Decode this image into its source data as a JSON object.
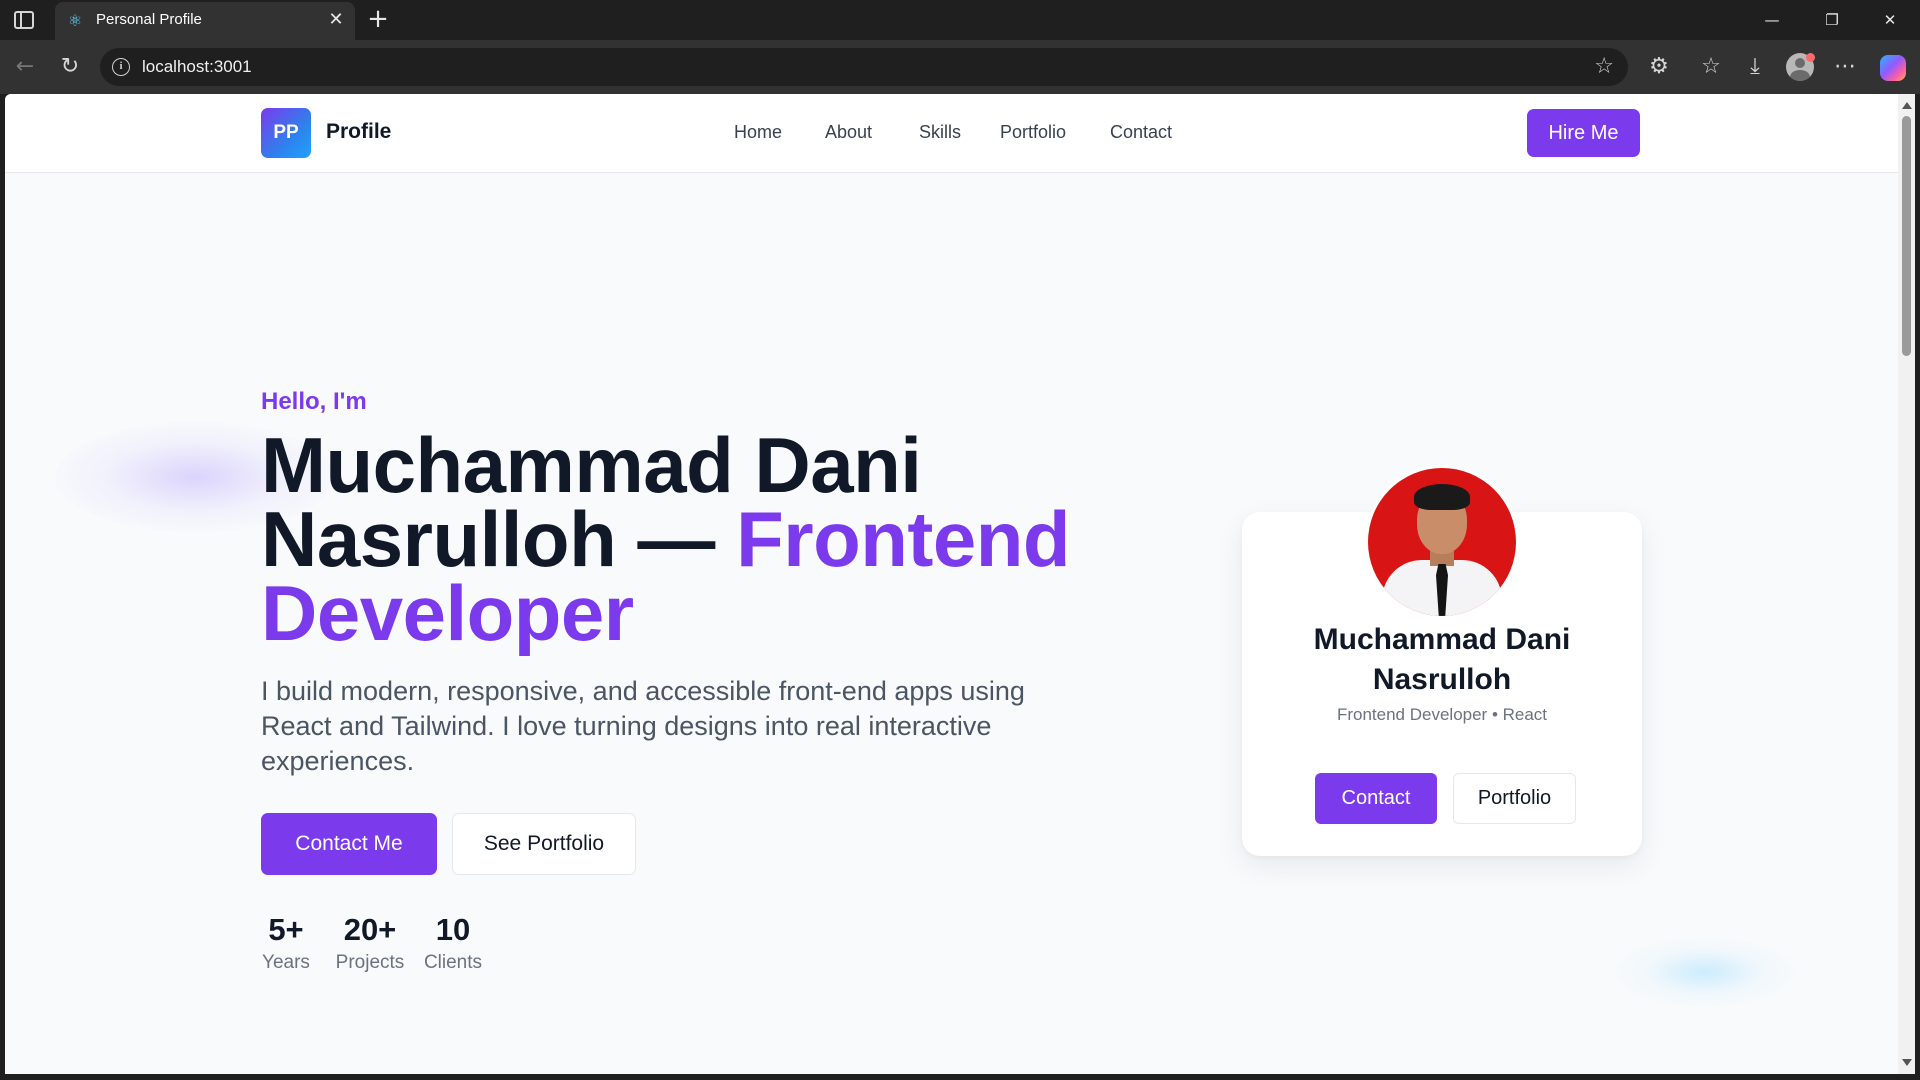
{
  "browser": {
    "tab_title": "Personal Profile",
    "tab_icon": "react-icon",
    "url": "localhost:3001",
    "accent_colors": {
      "chrome_dark": "#1f1f1f",
      "chrome_mid": "#323232"
    }
  },
  "site": {
    "logo_initials": "PP",
    "logo_text": "Profile",
    "nav": [
      "Home",
      "About",
      "Skills",
      "Portfolio",
      "Contact"
    ],
    "cta": "Hire Me",
    "brand_color": "#7c3aed"
  },
  "hero": {
    "greeting": "Hello, I'm",
    "headline_main": "Muchammad Dani Nasrulloh —",
    "headline_accent": "Frontend Developer",
    "lead": "I build modern, responsive, and accessible front-end apps using React and Tailwind. I love turning designs into real interactive experiences.",
    "primary_button": "Contact Me",
    "secondary_button": "See Portfolio",
    "stats": [
      {
        "value": "5+",
        "label": "Years"
      },
      {
        "value": "20+",
        "label": "Projects"
      },
      {
        "value": "10",
        "label": "Clients"
      }
    ]
  },
  "profile_card": {
    "name": "Muchammad Dani Nasrulloh",
    "subtitle": "Frontend Developer • React",
    "primary_button": "Contact",
    "secondary_button": "Portfolio"
  }
}
